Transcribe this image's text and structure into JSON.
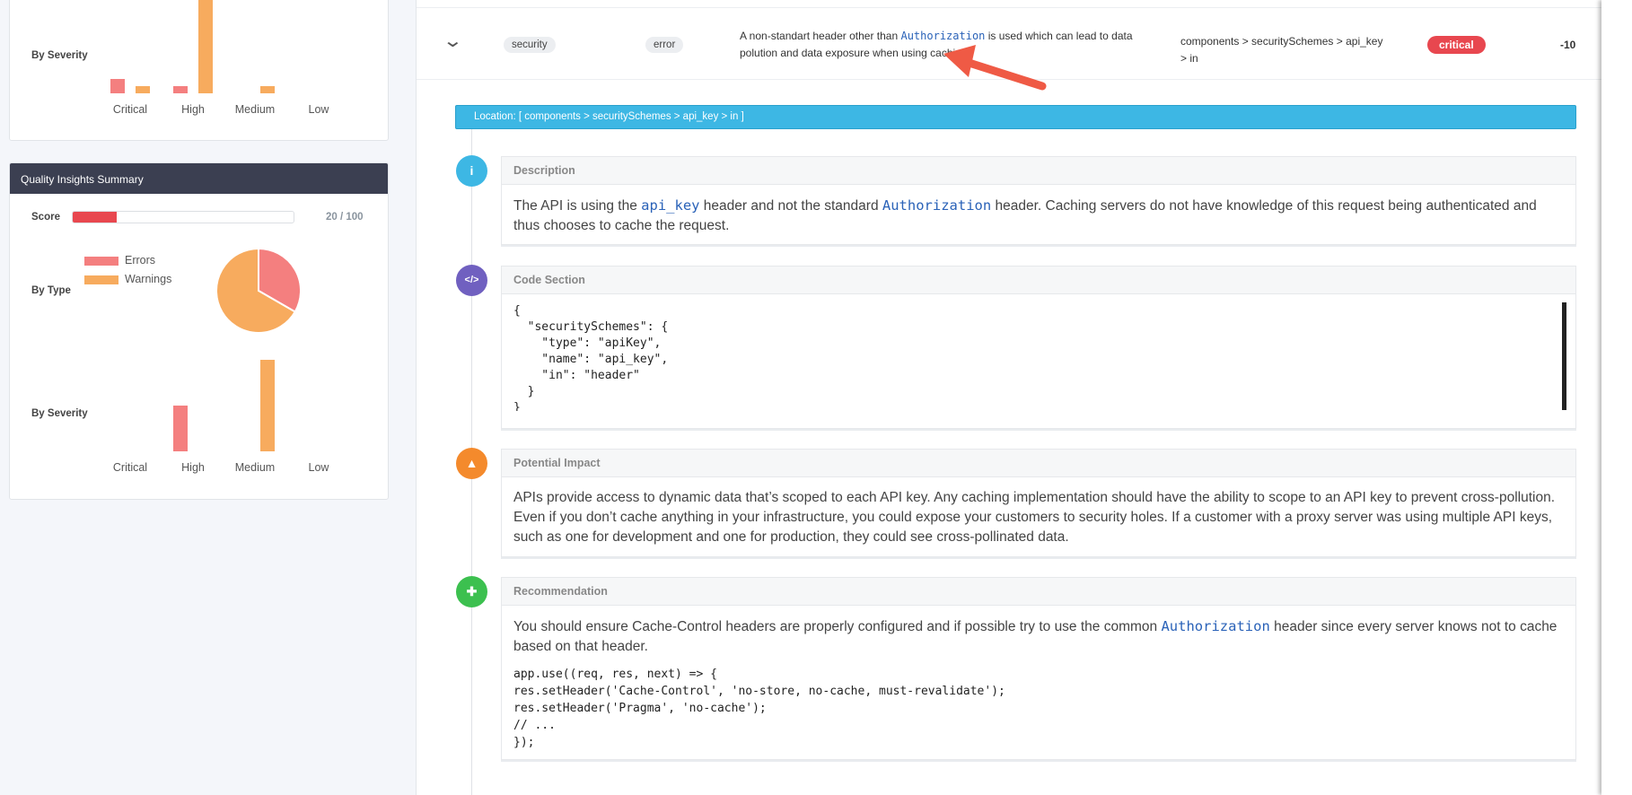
{
  "left_panel": {
    "top_card": {
      "by_severity_label": "By Severity"
    },
    "quality": {
      "title": "Quality Insights Summary",
      "score_label": "Score",
      "score": 20,
      "score_max": 100,
      "score_text": "20 / 100",
      "by_type_label": "By Type",
      "by_severity_label": "By Severity"
    }
  },
  "chart_data": [
    {
      "type": "bar",
      "categories": [
        "Critical",
        "High",
        "Medium",
        "Low"
      ],
      "series": [
        {
          "name": "Errors",
          "values": [
            2,
            1,
            0,
            0
          ]
        },
        {
          "name": "Warnings",
          "values": [
            1,
            14,
            1,
            0
          ]
        }
      ],
      "colors": [
        "#f47f7f",
        "#f7ab5e"
      ]
    },
    {
      "type": "pie",
      "categories": [
        "Errors",
        "Warnings"
      ],
      "values": [
        1,
        2
      ],
      "colors": [
        "#f47f7f",
        "#f7ab5e"
      ],
      "legend": "left"
    },
    {
      "type": "bar",
      "categories": [
        "Critical",
        "High",
        "Medium",
        "Low"
      ],
      "series": [
        {
          "name": "Errors",
          "values": [
            0,
            1,
            0,
            0
          ]
        },
        {
          "name": "Warnings",
          "values": [
            0,
            0,
            2,
            0
          ]
        }
      ],
      "colors": [
        "#f47f7f",
        "#f7ab5e"
      ]
    }
  ],
  "issue": {
    "category": "security",
    "type": "error",
    "desc_pre": "A non-standart header other than ",
    "desc_code": "Authorization",
    "desc_post": " is used which can lead to data polution and data exposure when using caching.",
    "path": "components > securitySchemes > api_key > in",
    "severity": "critical",
    "score": "-10",
    "location": "Location: [ components > securitySchemes > api_key > in ]"
  },
  "sections": {
    "description": {
      "title": "Description",
      "t1": "The API is using the ",
      "c1": "api_key",
      "t2": " header and not the standard ",
      "c2": "Authorization",
      "t3": " header. Caching servers do not have knowledge of this request being authenticated and thus chooses to cache the request."
    },
    "code": {
      "title": "Code Section",
      "code": "{\n  \"securitySchemes\": {\n    \"type\": \"apiKey\",\n    \"name\": \"api_key\",\n    \"in\": \"header\"\n  }\n}"
    },
    "impact": {
      "title": "Potential Impact",
      "text": "APIs provide access to dynamic data that’s scoped to each API key. Any caching implementation should have the ability to scope to an API key to prevent cross-pollution. Even if you don’t cache anything in your infrastructure, you could expose your customers to security holes. If a customer with a proxy server was using multiple API keys, such as one for development and one for production, they could see cross-pollinated data."
    },
    "recommendation": {
      "title": "Recommendation",
      "t1": "You should ensure Cache-Control headers are properly configured and if possible try to use the common ",
      "c1": "Authorization",
      "t2": " header since every server knows not to cache based on that header.",
      "code": "app.use((req, res, next) => {\nres.setHeader('Cache-Control', 'no-store, no-cache, must-revalidate');\nres.setHeader('Pragma', 'no-cache');\n// ...\n});"
    }
  },
  "colors": {
    "accent": "#3db7e4",
    "critical": "#e8474f",
    "dark_header": "#3b3f51",
    "info": "#3db7e4",
    "code": "#7060c0",
    "impact": "#f48a2c",
    "recommend": "#3cc04f"
  }
}
